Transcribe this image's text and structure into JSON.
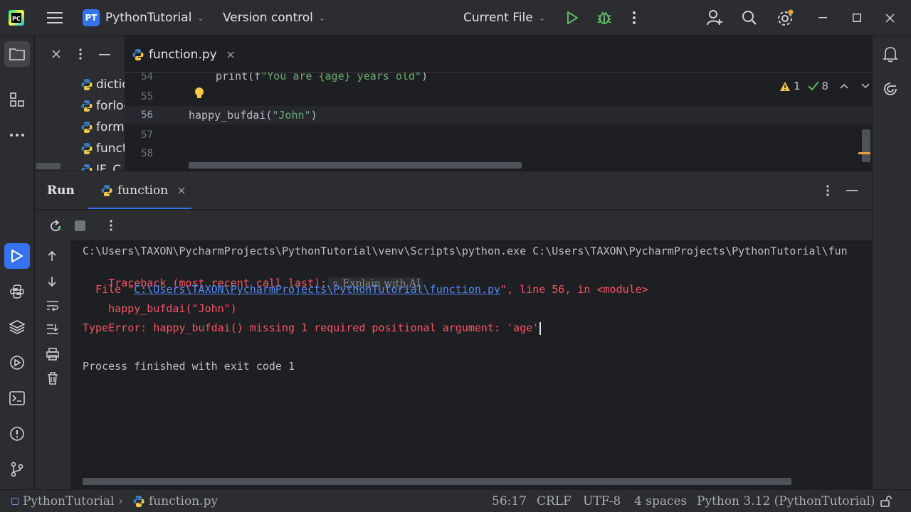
{
  "titlebar": {
    "project_badge": "PT",
    "project_name": "PythonTutorial",
    "vcs_label": "Version control",
    "run_config": "Current File"
  },
  "project_panel": {
    "files": [
      "dictio",
      "forloo",
      "forma",
      "functi",
      "IF_C"
    ]
  },
  "editor": {
    "tab_label": "function.py",
    "lines": [
      {
        "num": "54",
        "text": "print(f\"You are {age} years old\")"
      },
      {
        "num": "55",
        "text": ""
      },
      {
        "num": "56",
        "text": "happy_bufdai(\"John\")"
      },
      {
        "num": "57",
        "text": ""
      },
      {
        "num": "58",
        "text": ""
      }
    ],
    "code56_fn": "happy_bufdai(",
    "code56_str": "\"John\"",
    "code56_close": ")",
    "code54_print": "print(f",
    "code54_str": "\"You are {age} years old\"",
    "code54_close": ")",
    "warnings": "1",
    "checks": "8"
  },
  "run_panel": {
    "title": "Run",
    "tab_label": "function"
  },
  "console": {
    "cmd": "C:\\Users\\TAXON\\PycharmProjects\\PythonTutorial\\venv\\Scripts\\python.exe C:\\Users\\TAXON\\PycharmProjects\\PythonTutorial\\fun",
    "traceback": "Traceback (most recent call last):",
    "explain_ai": "Explain with AI",
    "file_prefix": "  File \"",
    "file_link": "C:\\Users\\TAXON\\PycharmProjects\\PythonTutorial\\function.py",
    "file_suffix": "\", line 56, in <module>",
    "code_line": "    happy_bufdai(\"John\")",
    "type_error": "TypeError: happy_bufdai() missing 1 required positional argument: 'age'",
    "finished": "Process finished with exit code 1"
  },
  "statusbar": {
    "project": "PythonTutorial",
    "file": "function.py",
    "position": "56:17",
    "line_sep": "CRLF",
    "encoding": "UTF-8",
    "indent": "4 spaces",
    "interpreter": "Python 3.12 (PythonTutorial)"
  },
  "colors": {
    "accent": "#3574f0",
    "error": "#f75464",
    "string": "#6aab73",
    "run_green": "#5fb865"
  }
}
